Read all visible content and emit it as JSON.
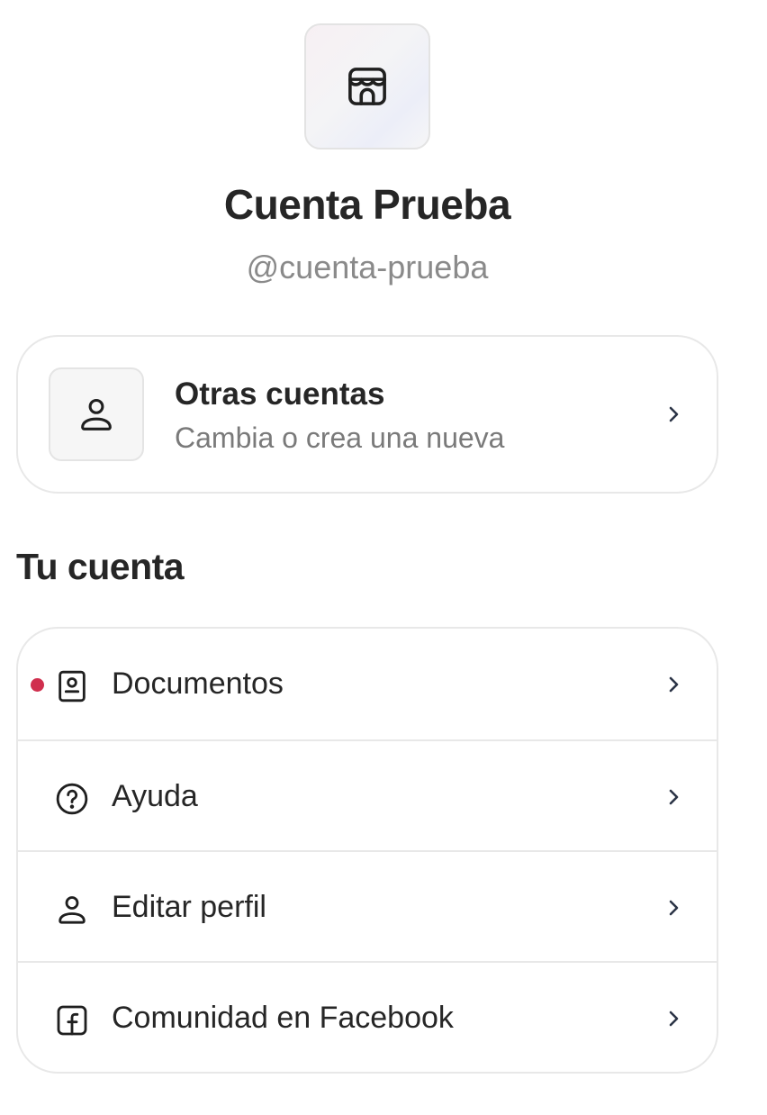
{
  "profile": {
    "icon": "storefront-icon",
    "name": "Cuenta Prueba",
    "handle": "@cuenta-prueba"
  },
  "other_accounts": {
    "icon": "user-icon",
    "title": "Otras cuentas",
    "subtitle": "Cambia o crea una nueva"
  },
  "section": {
    "title": "Tu cuenta"
  },
  "menu": {
    "items": [
      {
        "label": "Documentos",
        "icon": "document-id-icon",
        "notification": true
      },
      {
        "label": "Ayuda",
        "icon": "help-circle-icon",
        "notification": false
      },
      {
        "label": "Editar perfil",
        "icon": "user-icon",
        "notification": false
      },
      {
        "label": "Comunidad en Facebook",
        "icon": "facebook-icon",
        "notification": false
      }
    ]
  },
  "colors": {
    "notification_dot": "#d02f4e",
    "chevron": "#2b3446",
    "text_primary": "#262626",
    "text_secondary": "#7a7a7a"
  }
}
